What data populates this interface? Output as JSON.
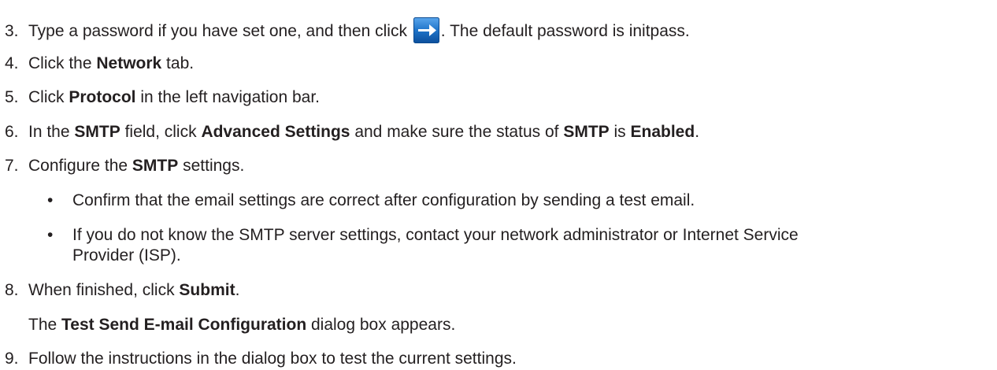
{
  "colors": {
    "text": "#231f20",
    "arrow_button_bg": "#1f74c9",
    "arrow_button_fg": "#ffffff"
  },
  "steps": [
    {
      "num": "3.",
      "a": "Type a password if you have set one, and then click ",
      "icon": "right-arrow-icon",
      "b": ". The default password is initpass."
    },
    {
      "num": "4.",
      "a": "Click the ",
      "b1": "Network",
      "c": " tab."
    },
    {
      "num": "5.",
      "a": "Click ",
      "b1": "Protocol",
      "c": " in the left navigation bar."
    },
    {
      "num": "6.",
      "a": "In the ",
      "b1": "SMTP",
      "c": " field, click ",
      "b2": "Advanced Settings",
      "d": " and make sure the status of ",
      "b3": "SMTP",
      "e": " is ",
      "b4": "Enabled",
      "f": "."
    },
    {
      "num": "7.",
      "a": "Configure the ",
      "b1": "SMTP",
      "c": " settings.",
      "bullets": [
        {
          "dot": "•",
          "text": "Confirm that the email settings are correct after configuration by sending a test email."
        },
        {
          "dot": "•",
          "line1": "If you do not know the SMTP server settings, contact your network administrator or Internet Service",
          "line2": "Provider (ISP)."
        }
      ]
    },
    {
      "num": "8.",
      "a": "When finished, click ",
      "b1": "Submit",
      "c": ".",
      "sub": {
        "a": "The ",
        "b1": "Test Send E-mail Configuration",
        "c": " dialog box appears."
      }
    },
    {
      "num": "9.",
      "a": "Follow the instructions in the dialog box to test the current settings."
    }
  ]
}
